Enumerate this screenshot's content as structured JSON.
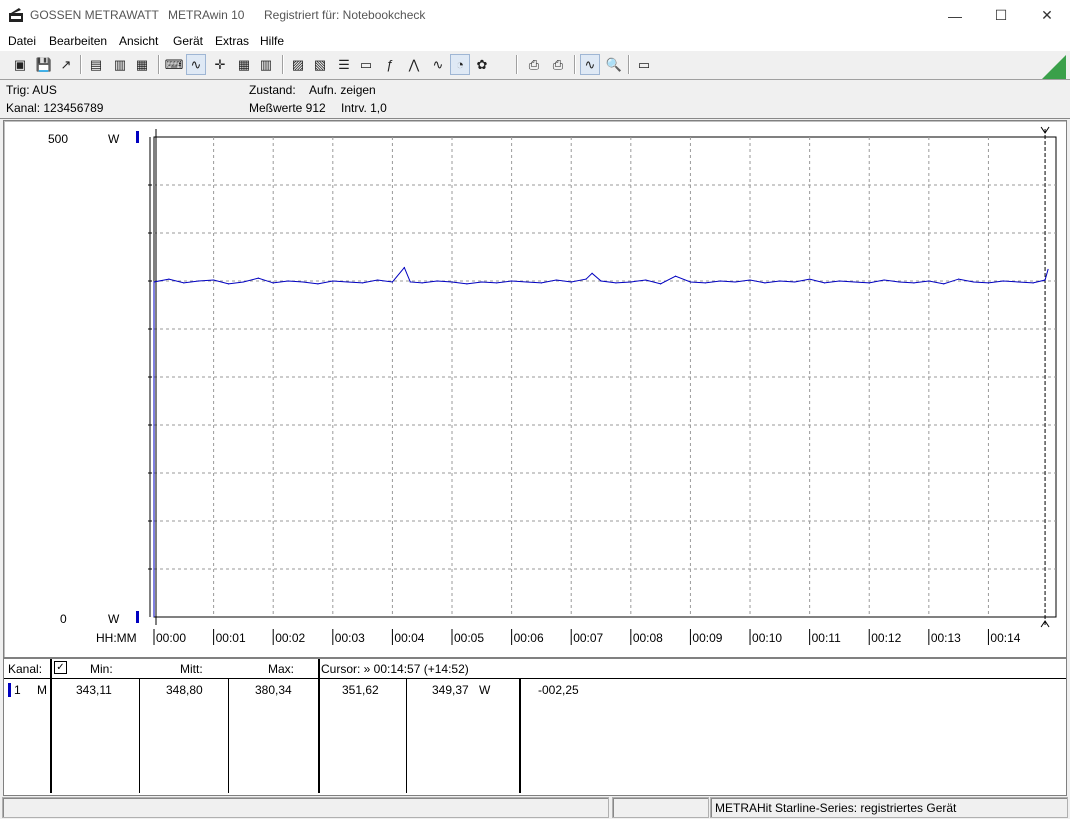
{
  "window": {
    "brand": "GOSSEN METRAWATT",
    "app": "METRAwin 10",
    "registered": "Registriert für: Notebookcheck",
    "controls": {
      "minimize": "—",
      "maximize": "☐",
      "close": "✕"
    }
  },
  "menu": [
    "Datei",
    "Bearbeiten",
    "Ansicht",
    "Gerät",
    "Extras",
    "Hilfe"
  ],
  "toolbar_icons": [
    "open-icon",
    "save-icon",
    "export-icon",
    "device-icon",
    "device2-icon",
    "device3-icon",
    "keyboard-icon",
    "wave-view-icon",
    "cross-view-icon",
    "table-view-icon",
    "bars-view-icon",
    "config1-icon",
    "config2-icon",
    "list-icon",
    "monitor-icon",
    "formula-icon",
    "signal1-icon",
    "signal2-icon",
    "probe-icon",
    "color-icon",
    "print-icon",
    "print-preview-icon",
    "zoom-wave-icon",
    "zoom-icon",
    "comment-icon"
  ],
  "info": {
    "trig": "Trig: AUS",
    "kanal": "Kanal: 123456789",
    "zustand_label": "Zustand:",
    "zustand_value": "Aufn. zeigen",
    "messwerte": "Meßwerte 912",
    "intrv": "Intrv. 1,0"
  },
  "chart_data": {
    "type": "line",
    "y_top_label": "500",
    "y_bottom_label": "0",
    "y_unit": "W",
    "ylim": [
      0,
      500
    ],
    "xlabel": "HH:MM",
    "x_ticks": [
      "00:00",
      "00:01",
      "00:02",
      "00:03",
      "00:04",
      "00:05",
      "00:06",
      "00:07",
      "00:08",
      "00:09",
      "00:10",
      "00:11",
      "00:12",
      "00:13",
      "00:14"
    ],
    "xlim_minutes": [
      0,
      15.1
    ],
    "grid": true,
    "series": [
      {
        "color": "#0000c0",
        "x_minutes": [
          0,
          0.25,
          0.5,
          0.75,
          1,
          1.25,
          1.5,
          1.75,
          2,
          2.25,
          2.5,
          2.75,
          3,
          3.25,
          3.5,
          3.75,
          4,
          4.2,
          4.3,
          4.5,
          4.75,
          5,
          5.25,
          5.5,
          5.75,
          6,
          6.25,
          6.5,
          6.75,
          7,
          7.25,
          7.35,
          7.5,
          7.75,
          8,
          8.25,
          8.5,
          8.75,
          9,
          9.25,
          9.5,
          9.75,
          10,
          10.25,
          10.5,
          10.75,
          11,
          11.25,
          11.5,
          11.75,
          12,
          12.25,
          12.5,
          12.75,
          13,
          13.25,
          13.5,
          13.75,
          14,
          14.25,
          14.5,
          14.75,
          14.95,
          15.0
        ],
        "values": [
          349,
          352,
          348,
          350,
          351,
          347,
          349,
          353,
          348,
          350,
          349,
          347,
          350,
          349,
          348,
          351,
          349,
          364,
          349,
          348,
          350,
          349,
          347,
          349,
          348,
          350,
          349,
          348,
          351,
          349,
          352,
          358,
          350,
          348,
          349,
          351,
          347,
          355,
          349,
          348,
          350,
          349,
          351,
          348,
          350,
          349,
          352,
          348,
          350,
          349,
          348,
          351,
          349,
          348,
          350,
          347,
          352,
          349,
          348,
          350,
          349,
          348,
          351,
          362
        ]
      }
    ]
  },
  "stats": {
    "header": {
      "kanal": "Kanal:",
      "min": "Min:",
      "mitt": "Mitt:",
      "max": "Max:",
      "cursor": "Cursor: » 00:14:57 (+14:52)"
    },
    "checkbox": true,
    "row": {
      "channel": "1",
      "mode": "M",
      "min": "343,11",
      "mitt": "348,80",
      "max": "380,34",
      "cursor1": "351,62",
      "cursor2": "349,37",
      "unit": "W",
      "delta": "-002,25"
    }
  },
  "status": {
    "right": "METRAHit Starline-Series: registriertes Gerät"
  }
}
